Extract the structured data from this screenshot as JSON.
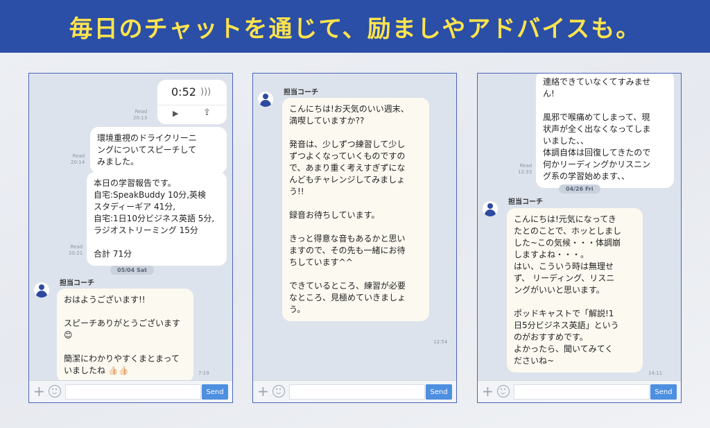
{
  "banner": {
    "title": "毎日のチャットを通じて、励ましやアドバイスも。"
  },
  "input": {
    "send_label": "Send"
  },
  "panel1": {
    "voice": {
      "duration": "0:52",
      "read": "Read",
      "time": "20:13"
    },
    "msg1": {
      "text": "環境重視のドライクリーニ\nングについてスピーチして\nみました。",
      "read": "Read",
      "time": "20:14"
    },
    "msg2": {
      "text": "本日の学習報告です。\n自宅:SpeakBuddy 10分,英検\nスタディーギア 41分,\n自宅:1日10分ビジネス英語 5分,\nラジオストリーミング 15分\n\n合計 71分",
      "read": "Read",
      "time": "20:21"
    },
    "date": "05/04 Sat",
    "coach_name": "担当コーチ",
    "coach_msg": {
      "text": "おはようございます!!\n\nスピーチありがとうございます\n😊\n\n簡潔にわかりやすくまとまって\nいましたね 👍🏻👍🏻",
      "time": "7:19"
    }
  },
  "panel2": {
    "coach_name": "担当コーチ",
    "coach_msg": {
      "text": "こんにちは!お天気のいい週末、\n満喫していますか??\n\n発音は、少しずつ練習して少し\nずつよくなっていくものですの\nで、あまり重く考えすぎずにな\nんどもチャレンジしてみましょ\nう!!\n\n録音お待ちしています。\n\nきっと得意な音もあるかと思い\nますので、その先も一緒にお待\nちしています^^\n\nできているところ、練習が必要\nなところ、見極めていきましょ\nう。",
      "time": "12:54"
    }
  },
  "panel3": {
    "msg1": {
      "text": "連絡できていなくてすみませ\nん!\n\n風邪で喉痛めてしまって、現\n状声が全く出なくなってしま\nいました、、\n体調自体は回復してきたので\n何かリーディングかリスニン\nグ系の学習始めます、、",
      "read": "Read",
      "time": "12:33"
    },
    "date": "04/26 Fri",
    "coach_name": "担当コーチ",
    "coach_msg": {
      "text": "こんにちは!元気になってき\nたとのことで、ホッとしまし\nした~この気候・・・体調崩\nしますよね・・・。\nはい、こういう時は無理せ\nず、 リーディング、リスニ\nングがいいと思います。\n\nポッドキャストで「解説!1\n日5分ビジネス英語」という\nのがおすすめです。\nよかったら、聞いてみてく\nださいね~",
      "time": "14:11"
    }
  }
}
